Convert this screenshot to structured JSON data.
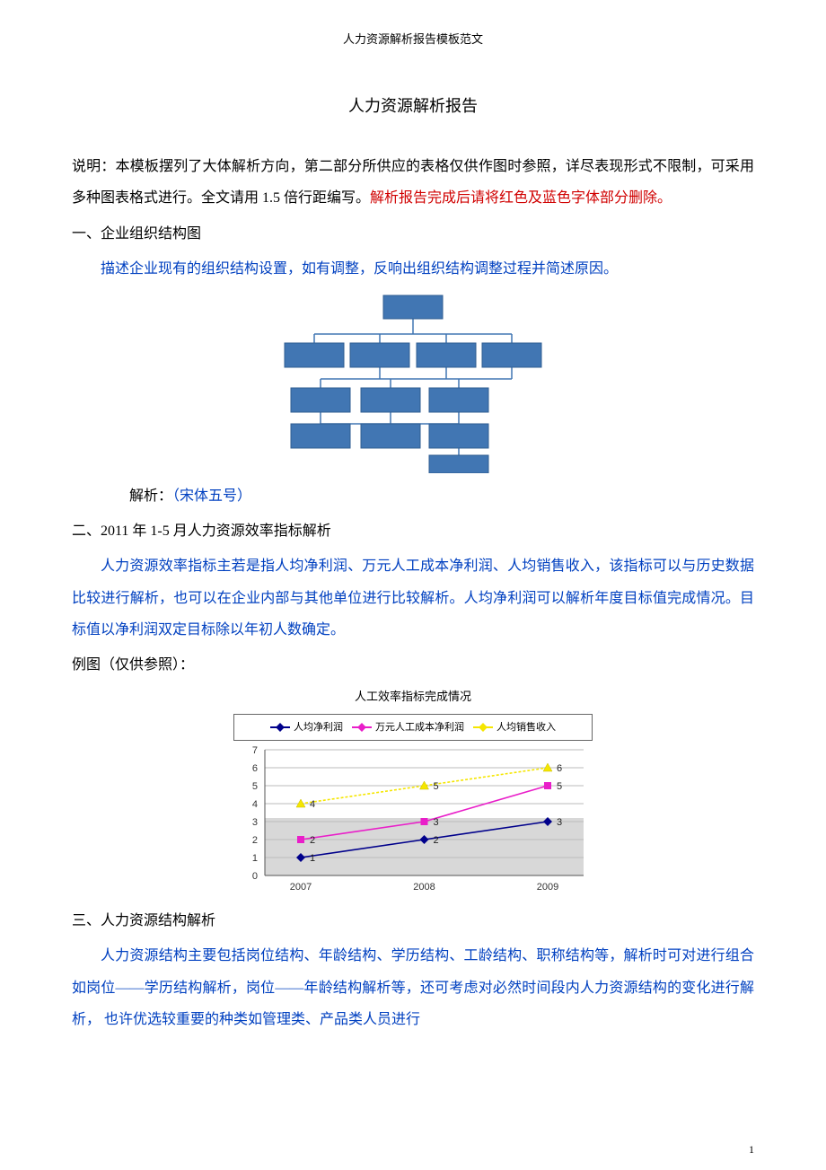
{
  "header_small": "人力资源解析报告模板范文",
  "title_main": "人力资源解析报告",
  "intro_plain": "说明：本模板摆列了大体解析方向，第二部分所供应的表格仅供作图时参照，详尽表现形式不限制，可采用多种图表格式进行。全文请用 1.5 倍行距编写。",
  "intro_red": "解析报告完成后请将红色及蓝色字体部分删除。",
  "s1_head": "一、企业组织结构图",
  "s1_blue": "描述企业现有的组织结构设置，如有调整，反响出组织结构调整过程并简述原因。",
  "s1_analysis_label": "解析：",
  "s1_analysis_note": "（宋体五号）",
  "s2_head": "二、2011 年 1-5 月人力资源效率指标解析",
  "s2_blue": "人力资源效率指标主若是指人均净利润、万元人工成本净利润、人均销售收入，该指标可以与历史数据比较进行解析，也可以在企业内部与其他单位进行比较解析。人均净利润可以解析年度目标值完成情况。目标值以净利润双定目标除以年初人数确定。",
  "s2_example": "例图（仅供参照）：",
  "s3_head": "三、人力资源结构解析",
  "s3_para": "人力资源结构主要包括岗位结构、年龄结构、学历结构、工龄结构、职称结构等，解析时可对进行组合如岗位——学历结构解析，岗位——年龄结构解析等，还可考虑对必然时间段内人力资源结构的变化进行解析， 也许优选较重要的种类如管理类、产品类人员进行",
  "page_number": "1",
  "chart_data": {
    "type": "line",
    "title": "人工效率指标完成情况",
    "xlabel": "",
    "ylabel": "",
    "categories": [
      "2007",
      "2008",
      "2009"
    ],
    "ylim": [
      0,
      7
    ],
    "yticks": [
      0,
      1,
      2,
      3,
      4,
      5,
      6,
      7
    ],
    "series": [
      {
        "name": "人均净利润",
        "values": [
          1,
          2,
          3
        ]
      },
      {
        "name": "万元人工成本净利润",
        "values": [
          2,
          3,
          5
        ]
      },
      {
        "name": "人均销售收入",
        "values": [
          4,
          5,
          6
        ]
      }
    ]
  }
}
